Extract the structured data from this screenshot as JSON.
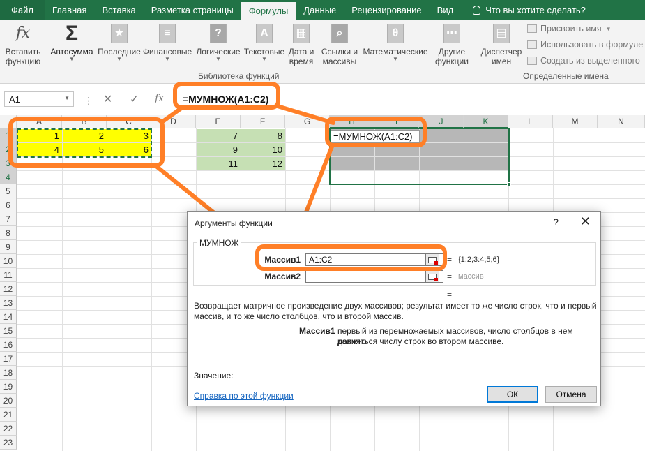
{
  "tabs": [
    "Файл",
    "Главная",
    "Вставка",
    "Разметка страницы",
    "Формулы",
    "Данные",
    "Рецензирование",
    "Вид"
  ],
  "tell_me": "Что вы хотите сделать?",
  "ribbon": {
    "insert_function": [
      "Вставить",
      "функцию"
    ],
    "autosum": "Автосумма",
    "recent": "Последние",
    "financial": "Финансовые",
    "logical": "Логические",
    "text": "Текстовые",
    "datetime": [
      "Дата и",
      "время"
    ],
    "lookup": [
      "Ссылки и",
      "массивы"
    ],
    "math": "Математические",
    "other": [
      "Другие",
      "функции"
    ],
    "library_label": "Библиотека функций",
    "name_manager": [
      "Диспетчер",
      "имен"
    ],
    "define_name": "Присвоить имя",
    "use_in_formula": "Использовать в формуле",
    "create_from_selection": "Создать из выделенного",
    "names_label": "Определенные имена"
  },
  "formula_bar": {
    "name_box": "A1",
    "formula": "=МУМНОЖ(A1:C2)",
    "fx": "fx",
    "cancel": "✕",
    "enter": "✓"
  },
  "columns": [
    "A",
    "B",
    "C",
    "D",
    "E",
    "F",
    "G",
    "H",
    "I",
    "J",
    "K",
    "L",
    "M",
    "N"
  ],
  "rows": [
    "1",
    "2",
    "3",
    "4",
    "5",
    "6",
    "7",
    "8",
    "9",
    "10",
    "11",
    "12",
    "13",
    "14",
    "15",
    "16",
    "17",
    "18",
    "19",
    "20",
    "21",
    "22",
    "23"
  ],
  "cells": {
    "A1": "1",
    "B1": "2",
    "C1": "3",
    "A2": "4",
    "B2": "5",
    "C2": "6",
    "E1": "7",
    "F1": "8",
    "E2": "9",
    "F2": "10",
    "E3": "11",
    "F3": "12"
  },
  "edit_cell_text": "=МУМНОЖ(A1:C2)",
  "dialog": {
    "title": "Аргументы функции",
    "help": "?",
    "close": "✕",
    "function_name": "МУМНОЖ",
    "arg1_label": "Массив1",
    "arg1_value": "A1:C2",
    "arg1_result": "{1;2;3:4;5;6}",
    "arg2_label": "Массив2",
    "arg2_value": "",
    "arg2_result": "массив",
    "eq": "=",
    "description_line1": "Возвращает матричное произведение двух массивов; результат имеет то же число строк, что и первый",
    "description_line2": "массив, и то же число столбцов, что и второй массив.",
    "arg_help_label": "Массив1",
    "arg_help_line1": "первый из перемножаемых массивов, число столбцов в нем должно",
    "arg_help_line2": "равняться числу строк во втором массиве.",
    "value_label": "Значение:",
    "help_link": "Справка по этой функции",
    "ok": "ОК",
    "cancel": "Отмена"
  }
}
